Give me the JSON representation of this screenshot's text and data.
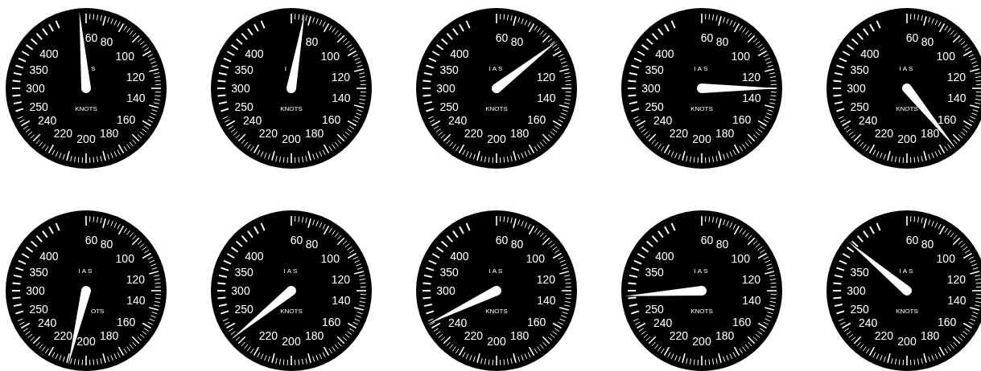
{
  "gauges": [
    {
      "title": "S",
      "unit": "KNOTS",
      "scale": [
        "60",
        "80",
        "400",
        "100",
        "350",
        "120",
        "300",
        "140",
        "250",
        "160",
        "240",
        "220",
        "180",
        "200"
      ]
    },
    {
      "title": "I",
      "unit": "KNOTS",
      "scale": [
        "80",
        "400",
        "100",
        "350",
        "120",
        "300",
        "140",
        "250",
        "160",
        "240",
        "220",
        "180",
        "200"
      ]
    },
    {
      "title": "IAS",
      "unit": "KNOTS",
      "scale": [
        "60",
        "80",
        "400",
        "350",
        "120",
        "300",
        "140",
        "250",
        "160",
        "240",
        "220",
        "180",
        "200"
      ]
    },
    {
      "title": "IAS",
      "unit": "KNOTS",
      "scale": [
        "60",
        "80",
        "400",
        "100",
        "350",
        "120",
        "300",
        "140",
        "250",
        "160",
        "240",
        "220",
        "180",
        "200"
      ]
    },
    {
      "title": "IAS",
      "unit": "KNOTS",
      "scale": [
        "60",
        "80",
        "400",
        "100",
        "350",
        "120",
        "300",
        "140",
        "250",
        "160",
        "240",
        "220",
        "180",
        "200"
      ]
    },
    {
      "title": "IAS",
      "unit": "OTS",
      "scale": [
        "60",
        "80",
        "400",
        "100",
        "350",
        "120",
        "300",
        "140",
        "250",
        "160",
        "240",
        "220",
        "180",
        "200"
      ]
    },
    {
      "title": "IAS",
      "unit": "KNOTS",
      "scale": [
        "60",
        "80",
        "400",
        "100",
        "350",
        "120",
        "300",
        "140",
        "250",
        "160",
        "220",
        "180",
        "200"
      ]
    },
    {
      "title": "IAS",
      "unit": "KNOTS",
      "scale": [
        "60",
        "80",
        "400",
        "100",
        "350",
        "120",
        "300",
        "140",
        "160",
        "240",
        "220",
        "180",
        "200"
      ]
    },
    {
      "title": "IAS",
      "unit": "KNOTS",
      "scale": [
        "60",
        "80",
        "400",
        "100",
        "350",
        "120",
        "140",
        "250",
        "160",
        "240",
        "220",
        "180",
        "200"
      ]
    },
    {
      "title": "IAS",
      "unit": "KNOTS",
      "scale": [
        "60",
        "80",
        "100",
        "350",
        "120",
        "300",
        "140",
        "250",
        "160",
        "240",
        "220",
        "180",
        "200"
      ]
    }
  ]
}
